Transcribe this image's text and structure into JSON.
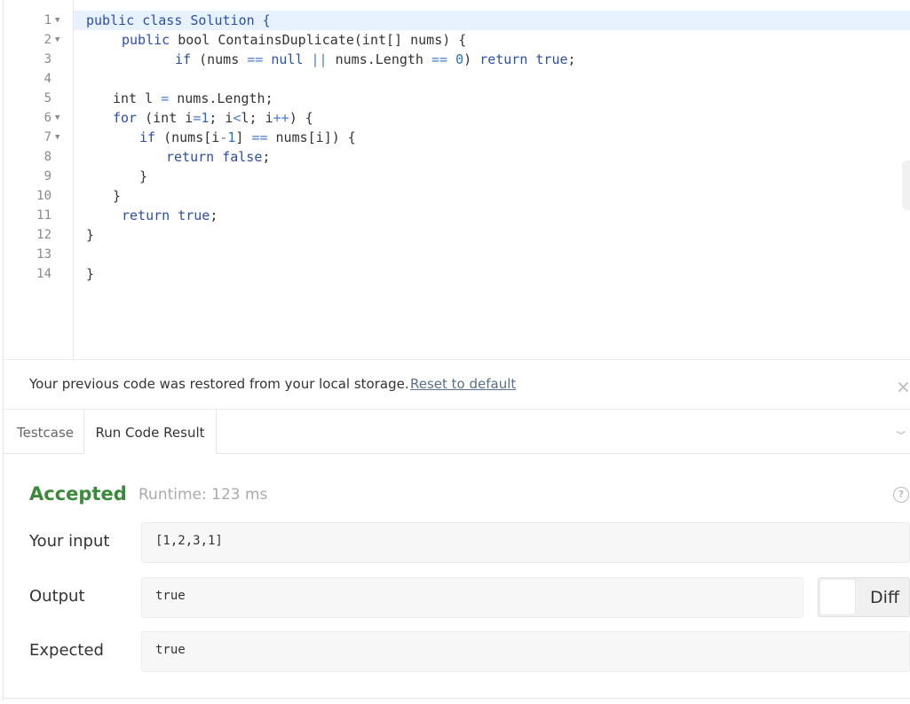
{
  "editor": {
    "lines": [
      {
        "n": "1",
        "fold": "▼",
        "indent": 0,
        "tokens": [
          {
            "t": "public class Solution {",
            "c": "kw"
          }
        ]
      },
      {
        "n": "2",
        "fold": "▼",
        "indent": 40,
        "tokens": [
          {
            "t": "public",
            "c": "kw"
          },
          {
            "t": " bool ContainsDuplicate(int[] nums) {",
            "c": ""
          }
        ]
      },
      {
        "n": "3",
        "fold": "",
        "indent": 100,
        "tokens": [
          {
            "t": "if",
            "c": "kw"
          },
          {
            "t": " (nums ",
            "c": ""
          },
          {
            "t": "==",
            "c": "op"
          },
          {
            "t": " ",
            "c": ""
          },
          {
            "t": "null",
            "c": "kw"
          },
          {
            "t": " ",
            "c": ""
          },
          {
            "t": "||",
            "c": "op"
          },
          {
            "t": " nums.Length ",
            "c": ""
          },
          {
            "t": "==",
            "c": "op"
          },
          {
            "t": " ",
            "c": ""
          },
          {
            "t": "0",
            "c": "num"
          },
          {
            "t": ") ",
            "c": ""
          },
          {
            "t": "return",
            "c": "kw"
          },
          {
            "t": " ",
            "c": ""
          },
          {
            "t": "true",
            "c": "kw"
          },
          {
            "t": ";",
            "c": ""
          }
        ]
      },
      {
        "n": "4",
        "fold": "",
        "indent": 0,
        "tokens": []
      },
      {
        "n": "5",
        "fold": "",
        "indent": 30,
        "tokens": [
          {
            "t": "int l ",
            "c": ""
          },
          {
            "t": "=",
            "c": "op"
          },
          {
            "t": " nums.Length;",
            "c": ""
          }
        ]
      },
      {
        "n": "6",
        "fold": "▼",
        "indent": 30,
        "tokens": [
          {
            "t": "for",
            "c": "kw"
          },
          {
            "t": " (int i",
            "c": ""
          },
          {
            "t": "=",
            "c": "op"
          },
          {
            "t": "1",
            "c": "num"
          },
          {
            "t": "; i",
            "c": ""
          },
          {
            "t": "<",
            "c": "op"
          },
          {
            "t": "l; i",
            "c": ""
          },
          {
            "t": "++",
            "c": "op"
          },
          {
            "t": ") {",
            "c": ""
          }
        ]
      },
      {
        "n": "7",
        "fold": "▼",
        "indent": 60,
        "tokens": [
          {
            "t": "if",
            "c": "kw"
          },
          {
            "t": " (nums[i",
            "c": ""
          },
          {
            "t": "-",
            "c": "op"
          },
          {
            "t": "1",
            "c": "num"
          },
          {
            "t": "] ",
            "c": ""
          },
          {
            "t": "==",
            "c": "op"
          },
          {
            "t": " nums[i]) {",
            "c": ""
          }
        ]
      },
      {
        "n": "8",
        "fold": "",
        "indent": 90,
        "tokens": [
          {
            "t": "return",
            "c": "kw"
          },
          {
            "t": " ",
            "c": ""
          },
          {
            "t": "false",
            "c": "kw"
          },
          {
            "t": ";",
            "c": ""
          }
        ]
      },
      {
        "n": "9",
        "fold": "",
        "indent": 60,
        "tokens": [
          {
            "t": "}",
            "c": ""
          }
        ]
      },
      {
        "n": "10",
        "fold": "",
        "indent": 30,
        "tokens": [
          {
            "t": "}",
            "c": ""
          }
        ]
      },
      {
        "n": "11",
        "fold": "",
        "indent": 40,
        "tokens": [
          {
            "t": "return",
            "c": "kw"
          },
          {
            "t": " ",
            "c": ""
          },
          {
            "t": "true",
            "c": "kw"
          },
          {
            "t": ";",
            "c": ""
          }
        ]
      },
      {
        "n": "12",
        "fold": "",
        "indent": 0,
        "tokens": [
          {
            "t": "}",
            "c": ""
          }
        ]
      },
      {
        "n": "13",
        "fold": "",
        "indent": 0,
        "tokens": []
      },
      {
        "n": "14",
        "fold": "",
        "indent": 0,
        "tokens": [
          {
            "t": "}",
            "c": ""
          }
        ]
      }
    ]
  },
  "banner": {
    "message": "Your previous code was restored from your local storage.",
    "reset_link": "Reset to default",
    "close_icon": "×"
  },
  "tabs": {
    "testcase": "Testcase",
    "run_result": "Run Code Result",
    "chevron_icon": "⌄"
  },
  "result": {
    "status": "Accepted",
    "runtime": "Runtime: 123 ms",
    "help_icon": "?",
    "input_label": "Your input",
    "input_value": "[1,2,3,1]",
    "output_label": "Output",
    "output_value": "true",
    "expected_label": "Expected",
    "expected_value": "true",
    "diff_label": "Diff"
  },
  "colors": {
    "accepted": "#3b8a3b",
    "keyword": "#2b4ea8",
    "active_line": "#e8f2ff"
  }
}
